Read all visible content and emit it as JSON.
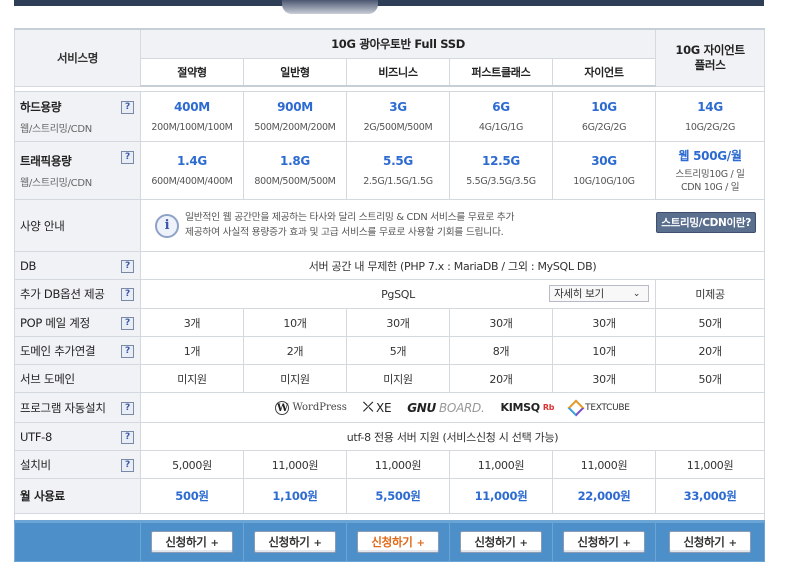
{
  "header": {
    "service_name": "서비스명",
    "group_title": "10G 광아우토반 Full SSD",
    "giant_title": "10G 자이언트 플러스",
    "tiers": [
      "절약형",
      "일반형",
      "비즈니스",
      "퍼스트클래스",
      "자이언트"
    ]
  },
  "help_icon": "?",
  "rows": {
    "disk": {
      "label": "하드용량",
      "sub": "웹/스트리밍/CDN",
      "values": [
        {
          "main": "400M",
          "detail": "200M/100M/100M"
        },
        {
          "main": "900M",
          "detail": "500M/200M/200M"
        },
        {
          "main": "3G",
          "detail": "2G/500M/500M"
        },
        {
          "main": "6G",
          "detail": "4G/1G/1G"
        },
        {
          "main": "10G",
          "detail": "6G/2G/2G"
        },
        {
          "main": "14G",
          "detail": "10G/2G/2G"
        }
      ]
    },
    "traffic": {
      "label": "트래픽용량",
      "sub": "웹/스트리밍/CDN",
      "values": [
        {
          "main": "1.4G",
          "detail": "600M/400M/400M"
        },
        {
          "main": "1.8G",
          "detail": "800M/500M/500M"
        },
        {
          "main": "5.5G",
          "detail": "2.5G/1.5G/1.5G"
        },
        {
          "main": "12.5G",
          "detail": "5.5G/3.5G/3.5G"
        },
        {
          "main": "30G",
          "detail": "10G/10G/10G"
        },
        {
          "main": "웹 500G/월",
          "detail1": "스트리밍10G / 일",
          "detail2": "CDN 10G / 일"
        }
      ]
    },
    "spec": {
      "label": "사양 안내",
      "info_line1": "일반적인 웹 공간만을 제공하는 타사와 달리 스트리밍 & CDN 서비스를 무료로 추가",
      "info_line2": "제공하여 사실적 용량증가 효과 및 고급 서비스를 무료로 사용할 기회를 드립니다.",
      "cdn_button": "스트리밍/CDN이란?"
    },
    "db": {
      "label": "DB",
      "value": "서버 공간 내 무제한 (PHP 7.x : MariaDB / 그외 : MySQL DB)"
    },
    "db_option": {
      "label": "추가 DB옵션 제공",
      "value": "PgSQL",
      "detail_button": "자세히 보기",
      "giant": "미제공"
    },
    "pop": {
      "label": "POP 메일 계정",
      "values": [
        "3개",
        "10개",
        "30개",
        "30개",
        "30개",
        "50개"
      ]
    },
    "domain": {
      "label": "도메인 추가연결",
      "values": [
        "1개",
        "2개",
        "5개",
        "8개",
        "10개",
        "20개"
      ]
    },
    "subdomain": {
      "label": "서브 도메인",
      "values": [
        "미지원",
        "미지원",
        "미지원",
        "20개",
        "30개",
        "50개"
      ]
    },
    "autoinstall": {
      "label": "프로그램 자동설치",
      "logos": {
        "wordpress": "WordPress",
        "xe": "XE",
        "gnu_a": "GNU",
        "gnu_b": "BOARD.",
        "kimsq": "KIMSQ",
        "kimsq_sup": "Rb",
        "textcube": "TEXTCUBE"
      }
    },
    "utf8": {
      "label": "UTF-8",
      "value": "utf-8 전용 서버 지원 (서비스신청 시 선택 가능)"
    },
    "setup": {
      "label": "설치비",
      "values": [
        "5,000원",
        "11,000원",
        "11,000원",
        "11,000원",
        "11,000원",
        "11,000원"
      ]
    },
    "monthly": {
      "label": "월 사용료",
      "values": [
        "500원",
        "1,100원",
        "5,500원",
        "11,000원",
        "22,000원",
        "33,000원"
      ]
    }
  },
  "footer": {
    "apply_label": "신청하기",
    "plus": "+"
  },
  "colors": {
    "accent_blue": "#2d6bd1",
    "footer_bar": "#4d90c9",
    "highlight_orange": "#e06a1a"
  }
}
